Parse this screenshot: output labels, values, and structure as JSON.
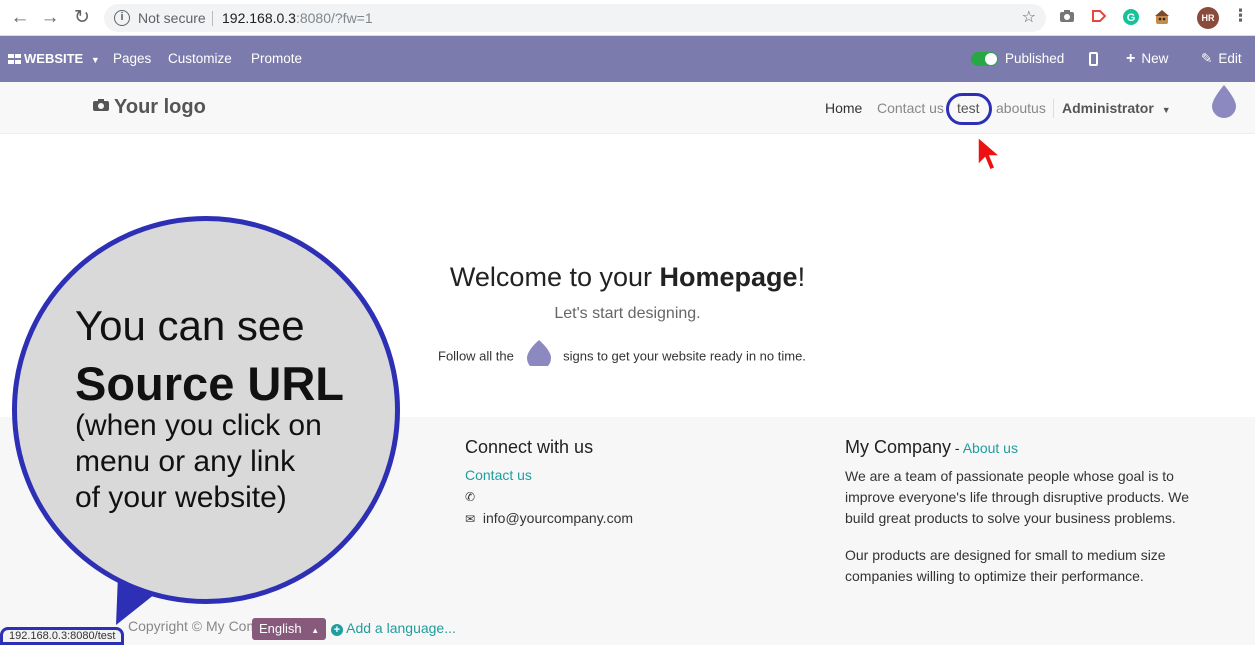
{
  "browser": {
    "back_icon": "←",
    "forward_icon": "→",
    "reload_icon": "↻",
    "security_text": "Not secure",
    "url_host": "192.168.0.3",
    "url_rest": ":8080/?fw=1",
    "star_icon": "☆",
    "avatar_initials": "HR",
    "menu_icon": "⋮"
  },
  "website_bar": {
    "website_label": "WEBSITE",
    "pages_label": "Pages",
    "customize_label": "Customize",
    "promote_label": "Promote",
    "published_label": "Published",
    "published_state": true,
    "new_label": "New",
    "edit_label": "Edit",
    "bar_color": "#7c7bad"
  },
  "site_header": {
    "logo_text": "Your logo",
    "menu": {
      "home": "Home",
      "contact": "Contact us",
      "test": "test",
      "aboutus": "aboutus",
      "admin": "Administrator"
    }
  },
  "main": {
    "welcome_prefix": "Welcome to your ",
    "welcome_bold": "Homepage",
    "welcome_suffix": "!",
    "subtitle": "Let's start designing.",
    "follow_prefix": "Follow all the",
    "follow_suffix": "signs to get your website ready in no time."
  },
  "footer": {
    "connect_title": "Connect with us",
    "contact_link": "Contact us",
    "email": "info@yourcompany.com",
    "company_title": "My Company",
    "company_dash": " - ",
    "about_link": "About us",
    "para1": "We are a team of passionate people whose goal is to improve everyone's life through disruptive products. We build great products to solve your business problems.",
    "para2": "Our products are designed for small to medium size companies willing to optimize their performance.",
    "copyright": "Copyright © My Company",
    "language": "English",
    "add_language": "Add a language..."
  },
  "callout": {
    "line1": "You can see",
    "line2": "Source URL",
    "line3a": "(when you click on",
    "line3b": "menu or any link",
    "line3c": "of your website)",
    "accent_color": "#2d2fb5"
  },
  "status_bar": {
    "url": "192.168.0.3:8080/test"
  }
}
